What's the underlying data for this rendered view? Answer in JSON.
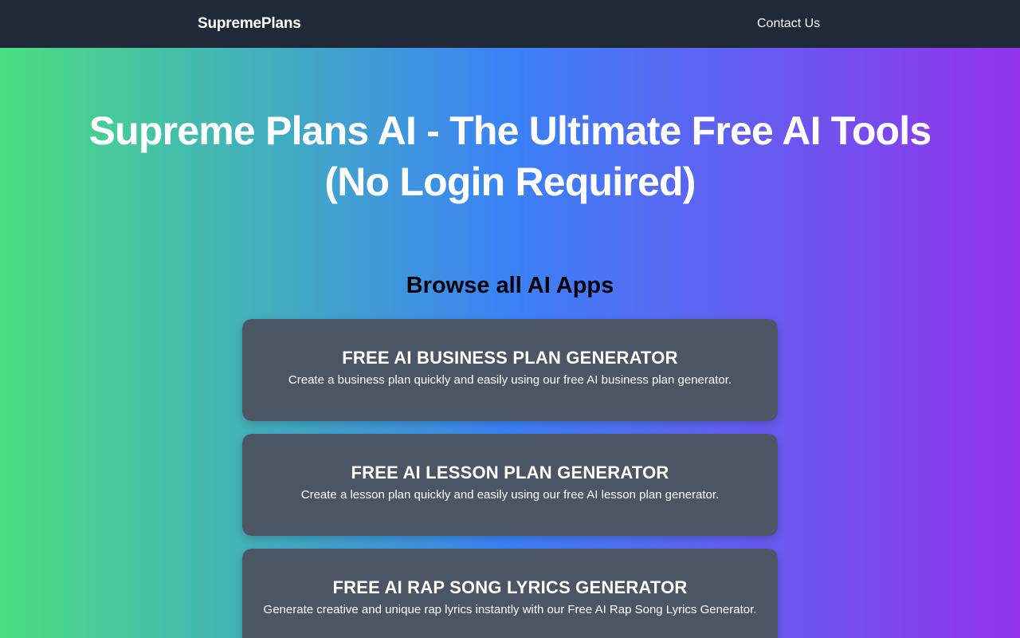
{
  "navbar": {
    "brand": "SupremePlans",
    "contact_label": "Contact Us"
  },
  "hero": {
    "title": "Supreme Plans AI - The Ultimate Free AI Tools (No Login Required)"
  },
  "browse": {
    "title": "Browse all AI Apps",
    "cards": [
      {
        "title": "FREE AI BUSINESS PLAN GENERATOR",
        "description": "Create a business plan quickly and easily using our free AI business plan generator."
      },
      {
        "title": "FREE AI LESSON PLAN GENERATOR",
        "description": "Create a lesson plan quickly and easily using our free AI lesson plan generator."
      },
      {
        "title": "FREE AI RAP SONG LYRICS GENERATOR",
        "description": "Generate creative and unique rap lyrics instantly with our Free AI Rap Song Lyrics Generator."
      }
    ]
  },
  "colors": {
    "navbar_bg": "#1f2937",
    "card_bg": "#4b5563",
    "gradient_start": "#4ade80",
    "gradient_mid": "#3b82f6",
    "gradient_end": "#9333ea"
  }
}
